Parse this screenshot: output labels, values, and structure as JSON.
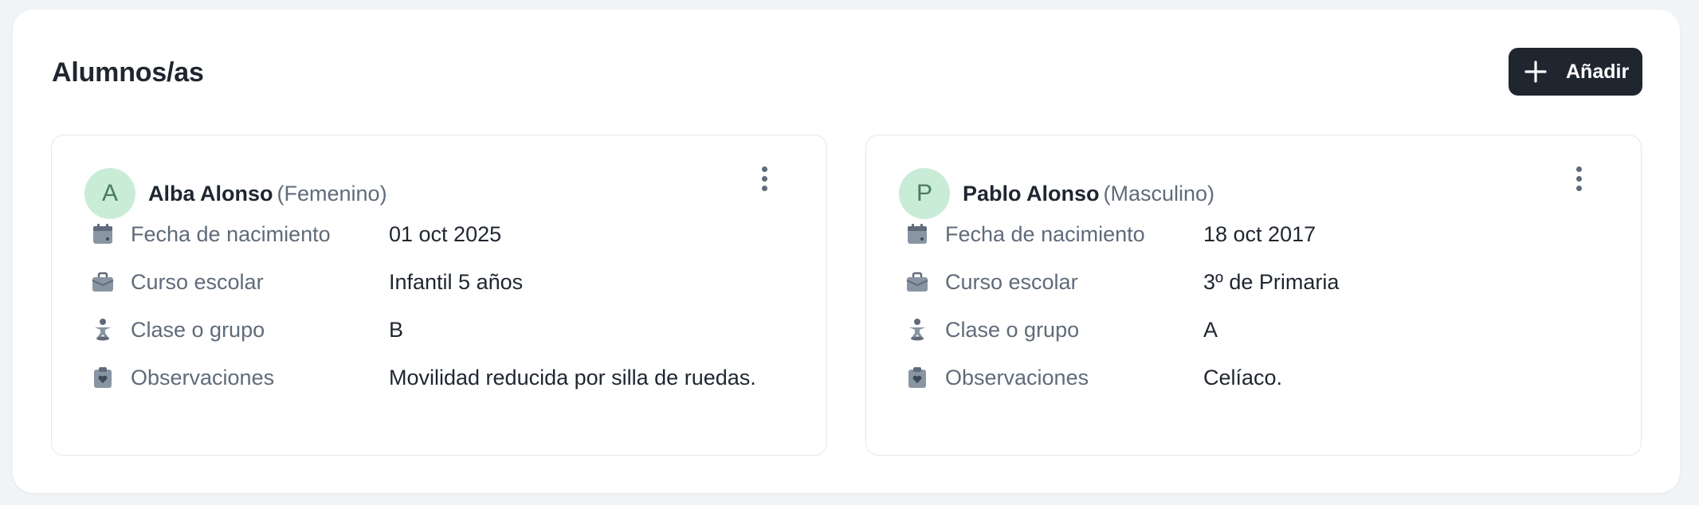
{
  "section": {
    "title": "Alumnos/as",
    "add_label": "Añadir"
  },
  "field_labels": {
    "birthdate": "Fecha de nacimiento",
    "course": "Curso escolar",
    "group": "Clase o grupo",
    "notes": "Observaciones"
  },
  "students": [
    {
      "initial": "A",
      "name": "Alba Alonso",
      "gender": "(Femenino)",
      "birthdate": "01 oct 2025",
      "course": "Infantil 5 años",
      "group": "B",
      "notes": "Movilidad reducida por silla de ruedas."
    },
    {
      "initial": "P",
      "name": "Pablo Alonso",
      "gender": "(Masculino)",
      "birthdate": "18 oct 2017",
      "course": "3º de Primaria",
      "group": "A",
      "notes": "Celíaco."
    }
  ],
  "colors": {
    "primary_button": "#1f2630",
    "avatar_bg": "#c9ecd7",
    "icon_gray": "#8a95a3",
    "muted_text": "#5f6b7a"
  }
}
